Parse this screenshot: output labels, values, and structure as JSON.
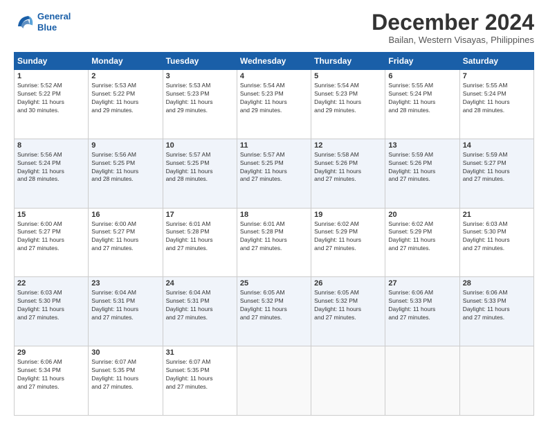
{
  "logo": {
    "line1": "General",
    "line2": "Blue"
  },
  "header": {
    "title": "December 2024",
    "subtitle": "Bailan, Western Visayas, Philippines"
  },
  "weekdays": [
    "Sunday",
    "Monday",
    "Tuesday",
    "Wednesday",
    "Thursday",
    "Friday",
    "Saturday"
  ],
  "weeks": [
    [
      {
        "day": "1",
        "info": "Sunrise: 5:52 AM\nSunset: 5:22 PM\nDaylight: 11 hours\nand 30 minutes."
      },
      {
        "day": "2",
        "info": "Sunrise: 5:53 AM\nSunset: 5:22 PM\nDaylight: 11 hours\nand 29 minutes."
      },
      {
        "day": "3",
        "info": "Sunrise: 5:53 AM\nSunset: 5:23 PM\nDaylight: 11 hours\nand 29 minutes."
      },
      {
        "day": "4",
        "info": "Sunrise: 5:54 AM\nSunset: 5:23 PM\nDaylight: 11 hours\nand 29 minutes."
      },
      {
        "day": "5",
        "info": "Sunrise: 5:54 AM\nSunset: 5:23 PM\nDaylight: 11 hours\nand 29 minutes."
      },
      {
        "day": "6",
        "info": "Sunrise: 5:55 AM\nSunset: 5:24 PM\nDaylight: 11 hours\nand 28 minutes."
      },
      {
        "day": "7",
        "info": "Sunrise: 5:55 AM\nSunset: 5:24 PM\nDaylight: 11 hours\nand 28 minutes."
      }
    ],
    [
      {
        "day": "8",
        "info": "Sunrise: 5:56 AM\nSunset: 5:24 PM\nDaylight: 11 hours\nand 28 minutes."
      },
      {
        "day": "9",
        "info": "Sunrise: 5:56 AM\nSunset: 5:25 PM\nDaylight: 11 hours\nand 28 minutes."
      },
      {
        "day": "10",
        "info": "Sunrise: 5:57 AM\nSunset: 5:25 PM\nDaylight: 11 hours\nand 28 minutes."
      },
      {
        "day": "11",
        "info": "Sunrise: 5:57 AM\nSunset: 5:25 PM\nDaylight: 11 hours\nand 27 minutes."
      },
      {
        "day": "12",
        "info": "Sunrise: 5:58 AM\nSunset: 5:26 PM\nDaylight: 11 hours\nand 27 minutes."
      },
      {
        "day": "13",
        "info": "Sunrise: 5:59 AM\nSunset: 5:26 PM\nDaylight: 11 hours\nand 27 minutes."
      },
      {
        "day": "14",
        "info": "Sunrise: 5:59 AM\nSunset: 5:27 PM\nDaylight: 11 hours\nand 27 minutes."
      }
    ],
    [
      {
        "day": "15",
        "info": "Sunrise: 6:00 AM\nSunset: 5:27 PM\nDaylight: 11 hours\nand 27 minutes."
      },
      {
        "day": "16",
        "info": "Sunrise: 6:00 AM\nSunset: 5:27 PM\nDaylight: 11 hours\nand 27 minutes."
      },
      {
        "day": "17",
        "info": "Sunrise: 6:01 AM\nSunset: 5:28 PM\nDaylight: 11 hours\nand 27 minutes."
      },
      {
        "day": "18",
        "info": "Sunrise: 6:01 AM\nSunset: 5:28 PM\nDaylight: 11 hours\nand 27 minutes."
      },
      {
        "day": "19",
        "info": "Sunrise: 6:02 AM\nSunset: 5:29 PM\nDaylight: 11 hours\nand 27 minutes."
      },
      {
        "day": "20",
        "info": "Sunrise: 6:02 AM\nSunset: 5:29 PM\nDaylight: 11 hours\nand 27 minutes."
      },
      {
        "day": "21",
        "info": "Sunrise: 6:03 AM\nSunset: 5:30 PM\nDaylight: 11 hours\nand 27 minutes."
      }
    ],
    [
      {
        "day": "22",
        "info": "Sunrise: 6:03 AM\nSunset: 5:30 PM\nDaylight: 11 hours\nand 27 minutes."
      },
      {
        "day": "23",
        "info": "Sunrise: 6:04 AM\nSunset: 5:31 PM\nDaylight: 11 hours\nand 27 minutes."
      },
      {
        "day": "24",
        "info": "Sunrise: 6:04 AM\nSunset: 5:31 PM\nDaylight: 11 hours\nand 27 minutes."
      },
      {
        "day": "25",
        "info": "Sunrise: 6:05 AM\nSunset: 5:32 PM\nDaylight: 11 hours\nand 27 minutes."
      },
      {
        "day": "26",
        "info": "Sunrise: 6:05 AM\nSunset: 5:32 PM\nDaylight: 11 hours\nand 27 minutes."
      },
      {
        "day": "27",
        "info": "Sunrise: 6:06 AM\nSunset: 5:33 PM\nDaylight: 11 hours\nand 27 minutes."
      },
      {
        "day": "28",
        "info": "Sunrise: 6:06 AM\nSunset: 5:33 PM\nDaylight: 11 hours\nand 27 minutes."
      }
    ],
    [
      {
        "day": "29",
        "info": "Sunrise: 6:06 AM\nSunset: 5:34 PM\nDaylight: 11 hours\nand 27 minutes."
      },
      {
        "day": "30",
        "info": "Sunrise: 6:07 AM\nSunset: 5:35 PM\nDaylight: 11 hours\nand 27 minutes."
      },
      {
        "day": "31",
        "info": "Sunrise: 6:07 AM\nSunset: 5:35 PM\nDaylight: 11 hours\nand 27 minutes."
      },
      {
        "day": "",
        "info": ""
      },
      {
        "day": "",
        "info": ""
      },
      {
        "day": "",
        "info": ""
      },
      {
        "day": "",
        "info": ""
      }
    ]
  ]
}
